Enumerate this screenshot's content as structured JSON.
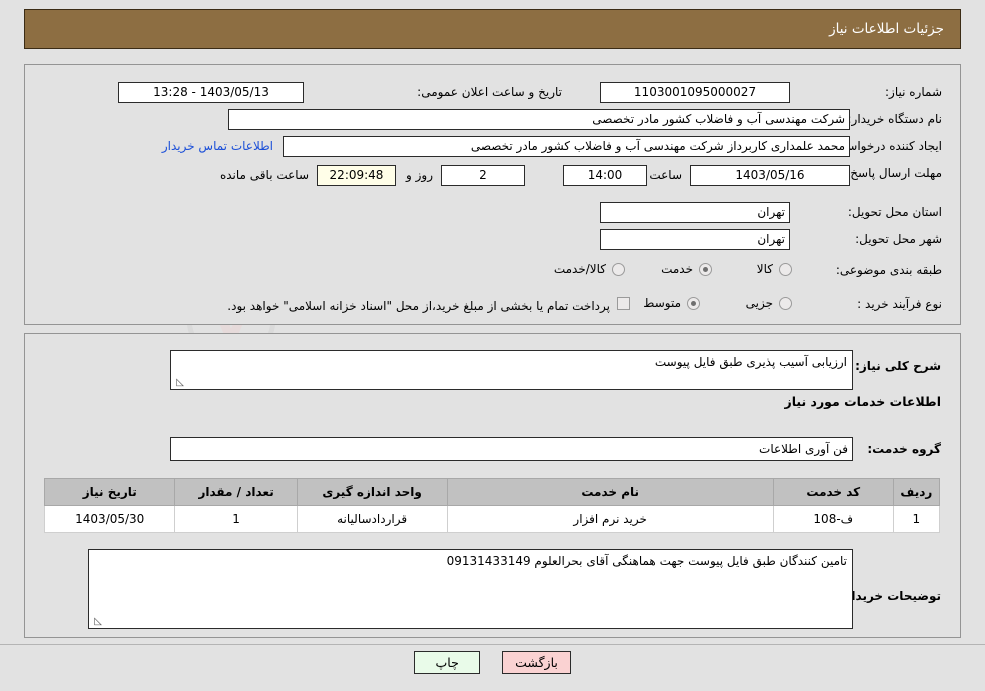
{
  "header": {
    "title": "جزئیات اطلاعات نیاز",
    "bg_color": "#8d6e42",
    "text_color": "#ffffff"
  },
  "watermark": {
    "text": "AriaTender.net",
    "mark": "W"
  },
  "top_form": {
    "need_number_label": "شماره نیاز:",
    "need_number_value": "1103001095000027",
    "public_announce_label": "تاریخ و ساعت اعلان عمومی:",
    "public_announce_value": "1403/05/13 - 13:28",
    "buyer_org_label": "نام دستگاه خریدار:",
    "buyer_org_value": "شرکت مهندسی  آب و فاضلاب کشور  مادر تخصصی",
    "requester_label": "ایجاد کننده درخواست:",
    "requester_value": "محمد علمداری کاربرداز شرکت مهندسی  آب و فاضلاب کشور  مادر تخصصی",
    "contact_link": "اطلاعات تماس خریدار",
    "deadline_label": "مهلت ارسال پاسخ: تا تاریخ:",
    "deadline_date": "1403/05/16",
    "hour_label": "ساعت",
    "deadline_time": "14:00",
    "days_value": "2",
    "days_label": "روز و",
    "countdown_value": "22:09:48",
    "remaining_label": "ساعت باقی مانده",
    "province_label": "استان محل تحویل:",
    "province_value": "تهران",
    "city_label": "شهر محل تحویل:",
    "city_value": "تهران",
    "category_label": "طبقه بندی موضوعی:",
    "category_options": [
      {
        "label": "کالا",
        "selected": false
      },
      {
        "label": "خدمت",
        "selected": true
      },
      {
        "label": "کالا/خدمت",
        "selected": false
      }
    ],
    "process_label": "نوع فرآیند خرید :",
    "process_options": [
      {
        "label": "جزیی",
        "selected": false
      },
      {
        "label": "متوسط",
        "selected": true
      }
    ],
    "treasury_checkbox_checked": false,
    "treasury_text": "پرداخت تمام یا بخشی از مبلغ خرید،از محل \"اسناد خزانه اسلامی\" خواهد بود."
  },
  "mid_form": {
    "general_desc_label": "شرح کلی نیاز:",
    "general_desc_value": "ارزیابی آسیب پذیری طبق فایل پیوست",
    "services_section_title": "اطلاعات خدمات مورد نیاز",
    "service_group_label": "گروه خدمت:",
    "service_group_value": "فن آوری اطلاعات",
    "buyer_notes_label": "توضیحات خریدار:",
    "buyer_notes_value": "تامین کنندگان طبق فایل پیوست جهت هماهنگی آقای بحرالعلوم 09131433149",
    "resize_grip": "◺"
  },
  "items_table": {
    "columns": [
      "ردیف",
      "کد خدمت",
      "نام خدمت",
      "واحد اندازه گیری",
      "تعداد / مقدار",
      "تاریخ نیاز"
    ],
    "rows": [
      [
        "1",
        "ف-108",
        "خرید نرم افزار",
        "قراردادسالیانه",
        "1",
        "1403/05/30"
      ]
    ]
  },
  "footer": {
    "print_label": "چاپ",
    "back_label": "بازگشت",
    "print_color": "#e9fbe9",
    "back_color": "#fad2d2"
  }
}
